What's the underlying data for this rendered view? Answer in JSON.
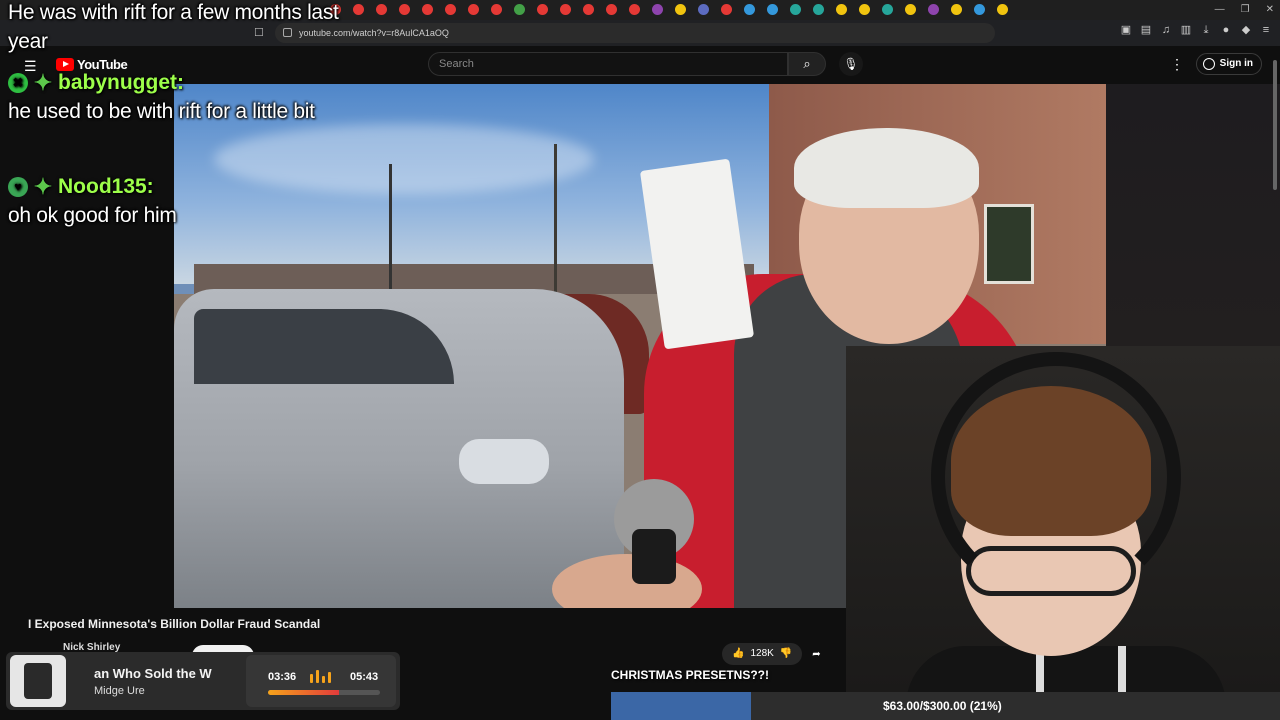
{
  "browser": {
    "url": "youtube.com/watch?v=r8AulCA1aOQ"
  },
  "youtube": {
    "logo_text": "YouTube",
    "search_placeholder": "Search",
    "signin_label": "Sign in"
  },
  "chat": [
    {
      "user": "",
      "text": "He was with rift for a few months last year"
    },
    {
      "user": "babynugget:",
      "text": "he used to be with rift for a little bit"
    },
    {
      "user": "Nood135:",
      "text": "oh ok good for him"
    }
  ],
  "video": {
    "title": "I Exposed Minnesota's Billion Dollar Fraud Scandal",
    "channel": "Nick Shirley",
    "likes": "128K"
  },
  "now_playing": {
    "title": "an Who Sold the W",
    "artist": "Midge Ure",
    "current_time": "03:36",
    "total_time": "05:43",
    "progress_fraction": 0.63
  },
  "goal": {
    "label": "CHRISTMAS PRESETNS??!",
    "text": "$63.00/$300.00 (21%)",
    "fraction": 0.21
  },
  "colors": {
    "chat_user": "#9dff4a",
    "goal_fill": "#3b67a6",
    "youtube_red": "#ff0000"
  }
}
